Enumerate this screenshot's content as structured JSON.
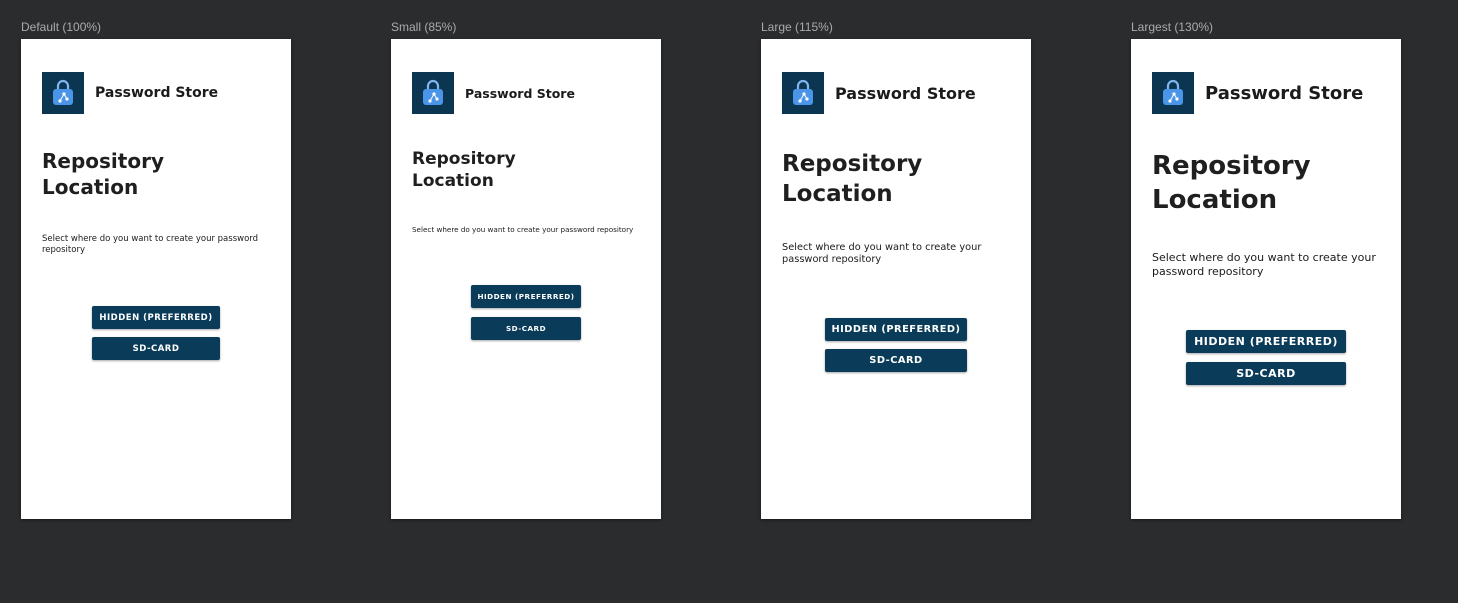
{
  "previews": [
    {
      "label": "Default (100%)",
      "app_name": "Password Store",
      "title": "Repository Location",
      "description": "Select where do you want to create your password repository",
      "hidden_button": "HIDDEN (PREFERRED)",
      "sdcard_button": "SD-CARD"
    },
    {
      "label": "Small (85%)",
      "app_name": "Password Store",
      "title": "Repository Location",
      "description": "Select where do you want to create your password repository",
      "hidden_button": "HIDDEN (PREFERRED)",
      "sdcard_button": "SD-CARD"
    },
    {
      "label": "Large (115%)",
      "app_name": "Password Store",
      "title": "Repository Location",
      "description": "Select where do you want to create your password repository",
      "hidden_button": "HIDDEN (PREFERRED)",
      "sdcard_button": "SD-CARD"
    },
    {
      "label": "Largest (130%)",
      "app_name": "Password Store",
      "title": "Repository Location",
      "description": "Select where do you want to create your password repository",
      "hidden_button": "HIDDEN (PREFERRED)",
      "sdcard_button": "SD-CARD"
    }
  ],
  "icons": {
    "app_icon": "lock-bag-icon"
  },
  "colors": {
    "background": "#2b2c2e",
    "phone": "#ffffff",
    "primary_button": "#0a3c5a",
    "app_icon_bg": "#0b3550",
    "app_icon_lock": "#4a95e8"
  }
}
